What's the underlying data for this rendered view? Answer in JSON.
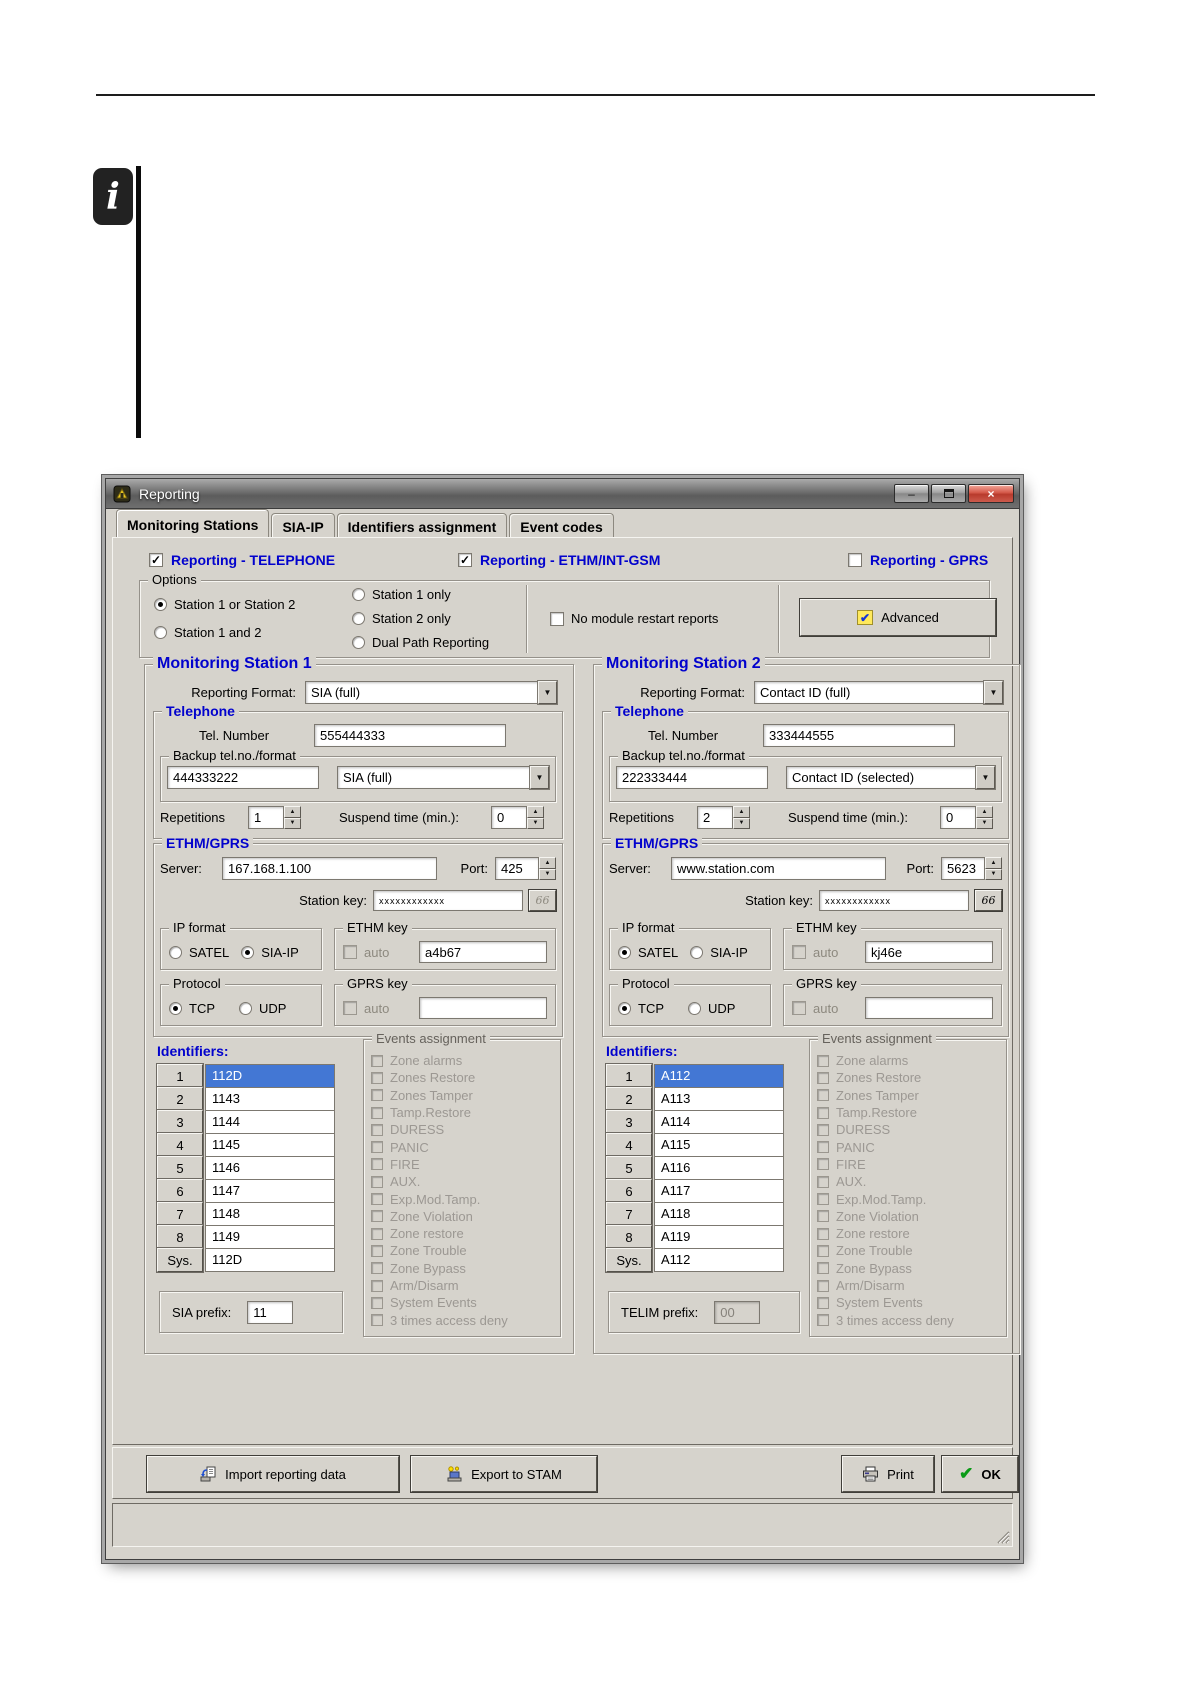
{
  "note": {
    "icon_glyph": "i"
  },
  "window": {
    "title": "Reporting"
  },
  "icons": {
    "minimize": "–",
    "close": "×",
    "dropdown": "▼",
    "spin_up": "▲",
    "spin_down": "▼",
    "check": "✓",
    "ok_check": "✔",
    "advanced_check": "✔",
    "reveal_key": "66"
  },
  "tabs": [
    {
      "label": "Monitoring Stations",
      "active": true
    },
    {
      "label": "SIA-IP",
      "active": false
    },
    {
      "label": "Identifiers assignment",
      "active": false
    },
    {
      "label": "Event codes",
      "active": false
    }
  ],
  "toggles": [
    {
      "label": "Reporting - TELEPHONE",
      "checked": true
    },
    {
      "label": "Reporting - ETHM/INT-GSM",
      "checked": true
    },
    {
      "label": "Reporting - GPRS",
      "checked": false
    }
  ],
  "options": {
    "title": "Options",
    "radios": [
      {
        "label": "Station 1 or Station 2",
        "selected": true
      },
      {
        "label": "Station 1 and 2",
        "selected": false
      },
      {
        "label": "Station 1 only",
        "selected": false
      },
      {
        "label": "Station 2 only",
        "selected": false
      },
      {
        "label": "Dual Path Reporting",
        "selected": false
      }
    ],
    "no_restart_label": "No module restart reports",
    "no_restart_checked": false,
    "advanced_label": "Advanced"
  },
  "labels": {
    "reporting_format": "Reporting Format:",
    "telephone": "Telephone",
    "tel_number": "Tel. Number",
    "backup": "Backup tel.no./format",
    "repetitions": "Repetitions",
    "suspend": "Suspend time (min.):",
    "ethm": "ETHM/GPRS",
    "server": "Server:",
    "port": "Port:",
    "station_key": "Station key:",
    "ip_format": "IP format",
    "satel": "SATEL",
    "siaip": "SIA-IP",
    "ethm_key": "ETHM key",
    "auto": "auto",
    "protocol": "Protocol",
    "tcp": "TCP",
    "udp": "UDP",
    "gprs_key": "GPRS key",
    "identifiers": "Identifiers:"
  },
  "events": {
    "title": "Events assignment",
    "items": [
      "Zone alarms",
      "Zones Restore",
      "Zones Tamper",
      "Tamp.Restore",
      "DURESS",
      "PANIC",
      "FIRE",
      "AUX.",
      "Exp.Mod.Tamp.",
      "Zone Violation",
      "Zone restore",
      "Zone Trouble",
      "Zone Bypass",
      "Arm/Disarm",
      "System Events",
      "3 times access deny"
    ]
  },
  "station1": {
    "title": "Monitoring Station 1",
    "reporting_format": "SIA (full)",
    "tel_number": "555444333",
    "backup_number": "444333222",
    "backup_format": "SIA (full)",
    "repetitions": "1",
    "suspend": "0",
    "server": "167.168.1.100",
    "port": "425",
    "station_key": "xxxxxxxxxxxx",
    "ip_satel_selected": false,
    "ip_siaip_selected": true,
    "ethm_key_auto": false,
    "ethm_key": "a4b67",
    "tcp_selected": true,
    "udp_selected": false,
    "gprs_key_auto": false,
    "gprs_key": "",
    "identifiers": [
      {
        "num": "1",
        "value": "112D",
        "selected": true
      },
      {
        "num": "2",
        "value": "1143",
        "selected": false
      },
      {
        "num": "3",
        "value": "1144",
        "selected": false
      },
      {
        "num": "4",
        "value": "1145",
        "selected": false
      },
      {
        "num": "5",
        "value": "1146",
        "selected": false
      },
      {
        "num": "6",
        "value": "1147",
        "selected": false
      },
      {
        "num": "7",
        "value": "1148",
        "selected": false
      },
      {
        "num": "8",
        "value": "1149",
        "selected": false
      },
      {
        "num": "Sys.",
        "value": "112D",
        "selected": false
      }
    ],
    "prefix_label": "SIA prefix:",
    "prefix_value": "11",
    "prefix_disabled": false
  },
  "station2": {
    "title": "Monitoring Station 2",
    "reporting_format": "Contact ID (full)",
    "tel_number": "333444555",
    "backup_number": "222333444",
    "backup_format": "Contact ID (selected)",
    "repetitions": "2",
    "suspend": "0",
    "server": "www.station.com",
    "port": "5623",
    "station_key": "xxxxxxxxxxxx",
    "ip_satel_selected": true,
    "ip_siaip_selected": false,
    "ethm_key_auto": false,
    "ethm_key": "kj46e",
    "tcp_selected": true,
    "udp_selected": false,
    "gprs_key_auto": false,
    "gprs_key": "",
    "identifiers": [
      {
        "num": "1",
        "value": "A112",
        "selected": true
      },
      {
        "num": "2",
        "value": "A113",
        "selected": false
      },
      {
        "num": "3",
        "value": "A114",
        "selected": false
      },
      {
        "num": "4",
        "value": "A115",
        "selected": false
      },
      {
        "num": "5",
        "value": "A116",
        "selected": false
      },
      {
        "num": "6",
        "value": "A117",
        "selected": false
      },
      {
        "num": "7",
        "value": "A118",
        "selected": false
      },
      {
        "num": "8",
        "value": "A119",
        "selected": false
      },
      {
        "num": "Sys.",
        "value": "A112",
        "selected": false
      }
    ],
    "prefix_label": "TELIM prefix:",
    "prefix_value": "00",
    "prefix_disabled": true
  },
  "footer": {
    "import_label": "Import reporting data",
    "export_label": "Export to STAM",
    "print_label": "Print",
    "ok_label": "OK"
  }
}
